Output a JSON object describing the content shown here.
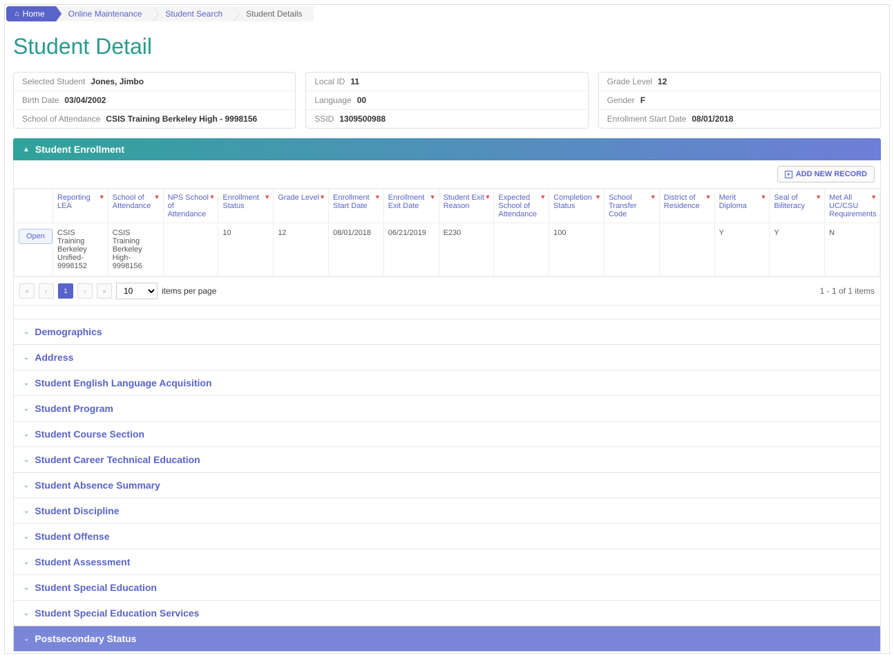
{
  "breadcrumb": [
    {
      "label": "Home",
      "home": true
    },
    {
      "label": "Online Maintenance"
    },
    {
      "label": "Student Search"
    },
    {
      "label": "Student Details",
      "last": true
    }
  ],
  "page_title": "Student Detail",
  "info": {
    "col1": [
      {
        "label": "Selected Student",
        "value": "Jones, Jimbo"
      },
      {
        "label": "Birth Date",
        "value": "03/04/2002"
      },
      {
        "label": "School of Attendance",
        "value": "CSIS Training Berkeley High - 9998156"
      }
    ],
    "col2": [
      {
        "label": "Local ID",
        "value": "11"
      },
      {
        "label": "Language",
        "value": "00"
      },
      {
        "label": "SSID",
        "value": "1309500988"
      }
    ],
    "col3": [
      {
        "label": "Grade Level",
        "value": "12"
      },
      {
        "label": "Gender",
        "value": "F"
      },
      {
        "label": "Enrollment Start Date",
        "value": "08/01/2018"
      }
    ]
  },
  "enrollment": {
    "title": "Student Enrollment",
    "add_label": "ADD NEW RECORD",
    "open_label": "Open",
    "columns": [
      "Reporting LEA",
      "School of Attendance",
      "NPS School of Attendance",
      "Enrollment Status",
      "Grade Level",
      "Enrollment Start Date",
      "Enrollment Exit Date",
      "Student Exit Reason",
      "Expected School of Attendance",
      "Completion Status",
      "School Transfer Code",
      "District of Residence",
      "Merit Diploma",
      "Seal of Biliteracy",
      "Met All UC/CSU Requirements"
    ],
    "row": {
      "reporting_lea": "CSIS Training Berkeley Unified-9998152",
      "school": "CSIS Training Berkeley High-9998156",
      "nps": "",
      "status": "10",
      "grade": "12",
      "start": "08/01/2018",
      "exit": "06/21/2019",
      "reason": "E230",
      "expected": "",
      "completion": "100",
      "transfer": "",
      "district": "",
      "merit": "Y",
      "seal": "Y",
      "uccsu": "N"
    }
  },
  "pager": {
    "current": "1",
    "page_size": "10",
    "per_page_label": "items per page",
    "summary": "1 - 1 of 1 items"
  },
  "accordion": [
    {
      "label": "Demographics"
    },
    {
      "label": "Address"
    },
    {
      "label": "Student English Language Acquisition"
    },
    {
      "label": "Student Program"
    },
    {
      "label": "Student Course Section"
    },
    {
      "label": "Student Career Technical Education"
    },
    {
      "label": "Student Absence Summary"
    },
    {
      "label": "Student Discipline"
    },
    {
      "label": "Student Offense"
    },
    {
      "label": "Student Assessment"
    },
    {
      "label": "Student Special Education"
    },
    {
      "label": "Student Special Education Services"
    },
    {
      "label": "Postsecondary Status",
      "active": true
    }
  ]
}
